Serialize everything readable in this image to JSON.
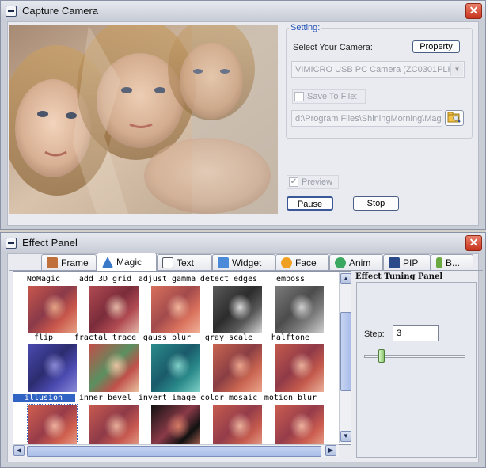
{
  "camera_window": {
    "title": "Capture Camera",
    "close_glyph": "✕",
    "group_label": "Setting:",
    "select_camera_label": "Select Your Camera:",
    "property_button": "Property",
    "camera_select_value": "VIMICRO USB PC Camera (ZC0301PLH)",
    "save_to_file_label": "Save To File:",
    "save_to_file_checked": false,
    "file_path_value": "d:\\Program Files\\ShiningMorning\\Magic",
    "preview_label": "Preview",
    "preview_checked": true,
    "pause_button": "Pause",
    "stop_button": "Stop"
  },
  "effect_window": {
    "title": "Effect Panel",
    "close_glyph": "✕",
    "tabs": [
      {
        "label": "Frame",
        "icon": "frame-icon",
        "color": "#c0703a"
      },
      {
        "label": "Magic",
        "icon": "magic-wand-icon",
        "color": "#3a78c8",
        "active": true
      },
      {
        "label": "Text",
        "icon": "text-edit-icon",
        "color": "#555b68"
      },
      {
        "label": "Widget",
        "icon": "widget-icon",
        "color": "#4a8ad8"
      },
      {
        "label": "Face",
        "icon": "face-icon",
        "color": "#f0a020"
      },
      {
        "label": "Anim",
        "icon": "anim-icon",
        "color": "#3aa860"
      },
      {
        "label": "PIP",
        "icon": "pip-icon",
        "color": "#2a4a8a"
      },
      {
        "label": "B...",
        "icon": "bottle-icon",
        "color": "#6aa840"
      }
    ],
    "effects": [
      {
        "label": "NoMagic",
        "tint": [
          "#c9574b",
          "#e6a486",
          "#8a3a4a"
        ]
      },
      {
        "label": "add 3D grid",
        "tint": [
          "#b04a52",
          "#e5b7a6",
          "#7a2c3a"
        ]
      },
      {
        "label": "adjust gamma",
        "tint": [
          "#d8705c",
          "#f1b39a",
          "#a24a4c"
        ]
      },
      {
        "label": "detect edges",
        "tint": [
          "#5a5a5a",
          "#d8d8d8",
          "#2c2c2c"
        ]
      },
      {
        "label": "emboss",
        "tint": [
          "#7c7c7c",
          "#d0d0d0",
          "#4c4c4c"
        ]
      },
      {
        "label": "flip",
        "tint": [
          "#4a4ab0",
          "#8a8ad8",
          "#2c2c70"
        ]
      },
      {
        "label": "fractal trace",
        "tint": [
          "#c0504a",
          "#e9c2a0",
          "#5a9060"
        ]
      },
      {
        "label": "gauss blur",
        "tint": [
          "#2a8a8a",
          "#80d0c8",
          "#1a5a6a"
        ]
      },
      {
        "label": "gray scale",
        "tint": [
          "#c86450",
          "#eca48c",
          "#8a3e44"
        ]
      },
      {
        "label": "halftone",
        "tint": [
          "#c45a4c",
          "#eab09a",
          "#903a48"
        ]
      },
      {
        "label": "illusion",
        "tint": [
          "#d0604e",
          "#efb29c",
          "#983c4a"
        ],
        "selected": true
      },
      {
        "label": "inner bevel",
        "tint": [
          "#c85a50",
          "#e8ae98",
          "#8e3a48"
        ]
      },
      {
        "label": "invert image",
        "tint": [
          "#111111",
          "#d27a64",
          "#8a3a48"
        ]
      },
      {
        "label": "color mosaic",
        "tint": [
          "#c65c4e",
          "#ebb09a",
          "#943c4a"
        ]
      },
      {
        "label": "motion blur",
        "tint": [
          "#cc5e50",
          "#eeb29c",
          "#963c4a"
        ]
      }
    ],
    "tuning_title": "Effect Tuning Panel",
    "step_label": "Step:",
    "step_value": "3",
    "slider_level": 0.15
  }
}
